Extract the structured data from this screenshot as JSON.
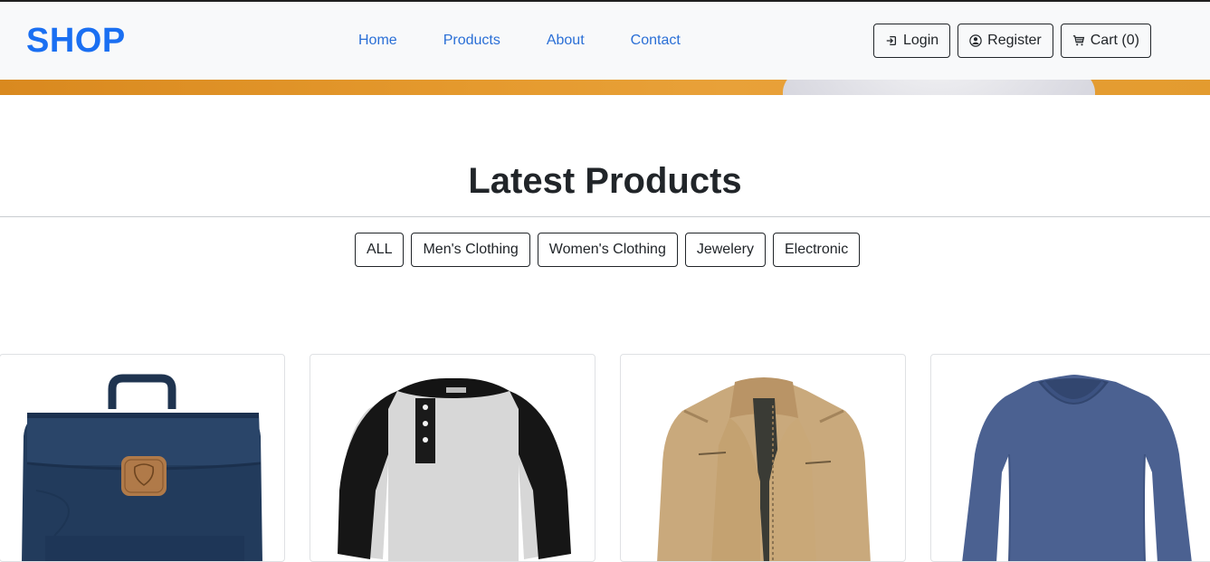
{
  "brand": {
    "name": "SHOP",
    "color": "#1a6ff2"
  },
  "nav": {
    "links": [
      {
        "label": "Home"
      },
      {
        "label": "Products"
      },
      {
        "label": "About"
      },
      {
        "label": "Contact"
      }
    ],
    "buttons": [
      {
        "label": "Login",
        "icon": "login-icon"
      },
      {
        "label": "Register",
        "icon": "user-circle-icon"
      },
      {
        "label": "Cart (0)",
        "icon": "cart-icon"
      }
    ]
  },
  "main": {
    "heading": "Latest Products",
    "filters": [
      "ALL",
      "Men's Clothing",
      "Women's Clothing",
      "Jewelery",
      "Electronic"
    ]
  },
  "products": [
    {
      "image": "backpack-image"
    },
    {
      "image": "raglan-tshirt-image"
    },
    {
      "image": "jacket-image"
    },
    {
      "image": "longsleeve-shirt-image"
    }
  ],
  "colors": {
    "link": "#2a6fd6",
    "hero": "#e39b2f",
    "navbar_bg": "#f8f9fa"
  }
}
